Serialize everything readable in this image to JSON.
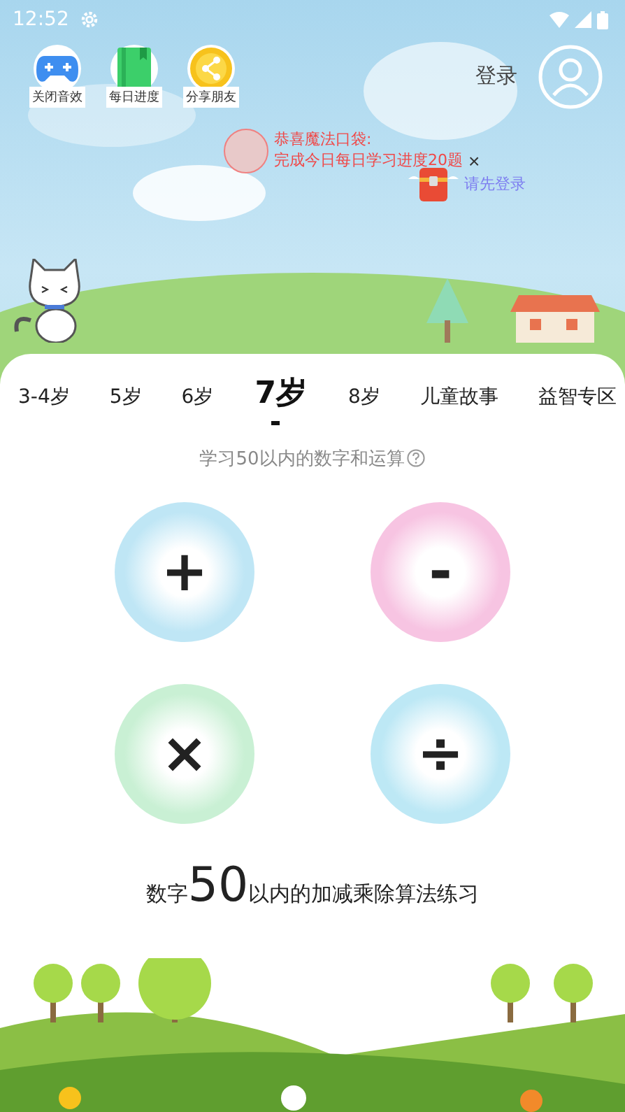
{
  "status_bar": {
    "time": "12:52"
  },
  "shortcuts": [
    {
      "kind": "gamepad",
      "label": "关闭音效"
    },
    {
      "kind": "book",
      "label": "每日进度"
    },
    {
      "kind": "share",
      "label": "分享朋友"
    }
  ],
  "account": {
    "login": "登录"
  },
  "notice": {
    "title": "恭喜魔法口袋:",
    "message": "完成今日每日学习进度20题",
    "close": "×",
    "login_prompt": "请先登录"
  },
  "tabs": [
    {
      "label": "3-4岁",
      "selected": false
    },
    {
      "label": "5岁",
      "selected": false
    },
    {
      "label": "6岁",
      "selected": false
    },
    {
      "label": "7岁",
      "selected": true
    },
    {
      "label": "8岁",
      "selected": false
    },
    {
      "label": "儿童故事",
      "selected": false
    },
    {
      "label": "益智专区",
      "selected": false
    }
  ],
  "subtitle": "学习50以内的数字和运算",
  "operations": [
    {
      "symbol": "+",
      "color": "#bfe6f5"
    },
    {
      "symbol": "-",
      "color": "#f7c4e2"
    },
    {
      "symbol": "×",
      "color": "#c9f0d4"
    },
    {
      "symbol": "÷",
      "color": "#bde8f5"
    }
  ],
  "summary": {
    "prefix": "数字",
    "number": "50",
    "suffix": "以内的加减乘除算法练习"
  }
}
